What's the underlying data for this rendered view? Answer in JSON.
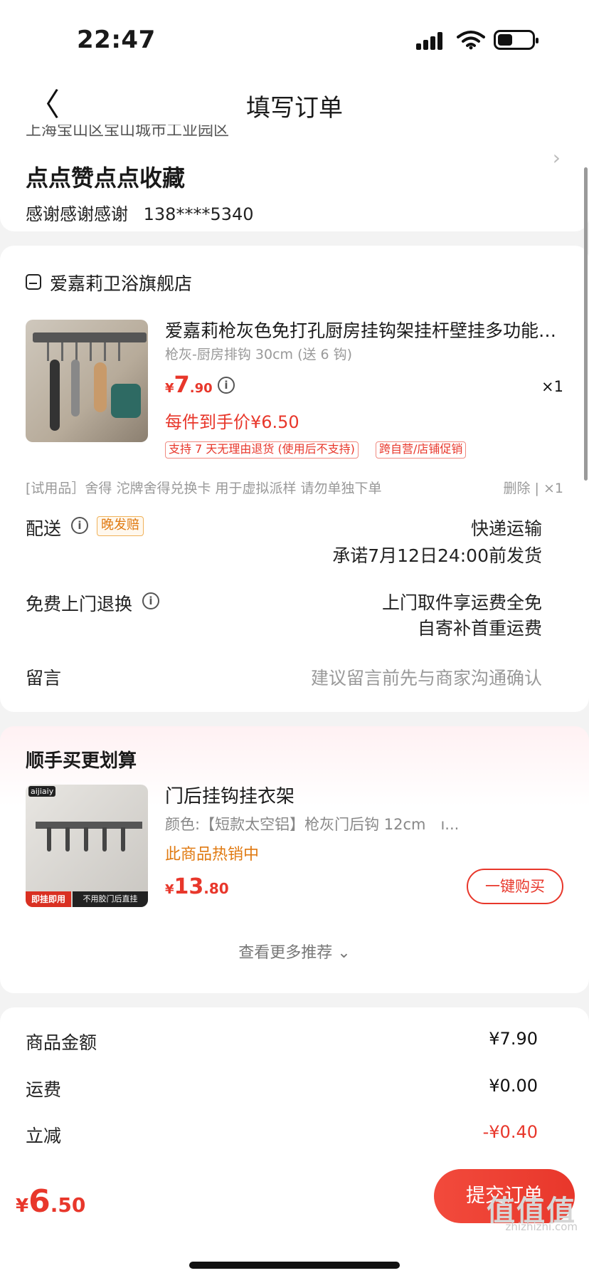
{
  "status": {
    "time": "22:47"
  },
  "nav": {
    "title": "填写订单",
    "back_glyph": "〈"
  },
  "address": {
    "top_line": "上海宝山区宝山城市工业园区",
    "name": "点点赞点点收藏",
    "contact_name": "感谢感谢感谢",
    "phone": "138****5340",
    "chevron": "›"
  },
  "order": {
    "store_name": "爱嘉莉卫浴旗舰店",
    "product_title": "爱嘉莉枪灰色免打孔厨房挂钩架挂杆壁挂多功能…",
    "product_spec": "枪灰-厨房排钩 30cm (送 6 钩)",
    "price_symbol": "¥",
    "price_int": "7",
    "price_dec": ".90",
    "quantity": "×1",
    "final_price": "每件到手价¥6.50",
    "tags": [
      "支持 7 天无理由退货 (使用后不支持)",
      "跨自营/店铺促销"
    ],
    "trial_text": "[试用品］舍得 沱牌舍得兑换卡 用于虚拟派样 请勿单独下单",
    "trial_actions": "删除 | ×1",
    "shipping_label": "配送",
    "late_badge": "晚发赔",
    "shipping_method": "快递运输",
    "shipping_promise": "承诺7月12日24:00前发货",
    "return_label": "免费上门退换",
    "return_line1": "上门取件享运费全免",
    "return_line2": "自寄补首重运费",
    "message_label": "留言",
    "message_placeholder": "建议留言前先与商家沟通确认",
    "info_glyph": "i"
  },
  "recommend": {
    "title": "顺手买更划算",
    "logo_text": "aijiaiy",
    "banner1": "即挂即用",
    "banner2": "不用胶门后直挂",
    "name": "门后挂钩挂衣架",
    "spec": "颜色:【短款太空铝】枪灰门后钩 12cm　ı...",
    "hot": "此商品热销中",
    "price_symbol": "¥",
    "price_int": "13",
    "price_dec": ".80",
    "buy_label": "一键购买",
    "more_label": "查看更多推荐 ⌄"
  },
  "summary": {
    "items": [
      {
        "label": "商品金额",
        "value": "¥7.90"
      },
      {
        "label": "运费",
        "value": "¥0.00"
      },
      {
        "label": "立减",
        "value": "-¥0.40"
      }
    ]
  },
  "bottom": {
    "total_symbol": "¥",
    "total_int": "6",
    "total_dec": ".50",
    "submit_label": "提交订单",
    "watermark_big": "值值值",
    "watermark": "zhizhizhi.com"
  },
  "colors": {
    "accent": "#e8372b",
    "warning": "#e07a12",
    "background": "#f3f3f3"
  },
  "icons": [
    "back-chevron-icon",
    "signal-icon",
    "wifi-icon",
    "battery-icon",
    "store-icon",
    "info-icon",
    "chevron-right-icon"
  ]
}
